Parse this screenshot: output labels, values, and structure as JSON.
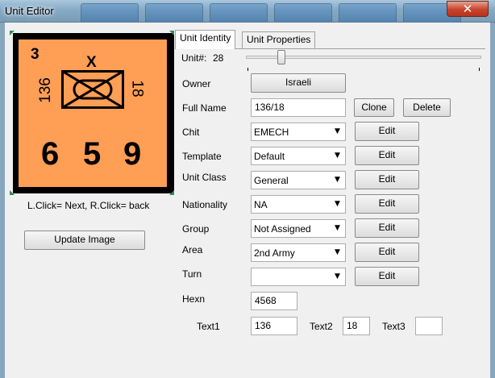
{
  "window": {
    "title": "Unit Editor",
    "close_glyph": "✕"
  },
  "counter": {
    "strength": "3",
    "size": "X",
    "left_label": "136",
    "right_label": "18",
    "stats": [
      "6",
      "5",
      "9"
    ],
    "bg_color": "#ff9e55",
    "corner_color": "#2f8a5a"
  },
  "hint": "L.Click= Next, R.Click= back",
  "update_image_label": "Update Image",
  "tabs": [
    "Unit Identity",
    "Unit Properties"
  ],
  "unit_number": {
    "label": "Unit#:",
    "value": "28"
  },
  "fields": {
    "owner": {
      "label": "Owner",
      "button": "Israeli"
    },
    "full_name": {
      "label": "Full Name",
      "value": "136/18",
      "clone": "Clone",
      "delete": "Delete"
    },
    "chit": {
      "label": "Chit",
      "value": "EMECH",
      "edit": "Edit"
    },
    "template": {
      "label": "Template",
      "value": "Default",
      "edit": "Edit"
    },
    "unit_class": {
      "label": "Unit Class",
      "value": "General",
      "edit": "Edit"
    },
    "nationality": {
      "label": "Nationality",
      "value": "NA",
      "edit": "Edit"
    },
    "group": {
      "label": "Group",
      "value": "Not Assigned",
      "edit": "Edit"
    },
    "area": {
      "label": "Area",
      "value": "2nd Army",
      "edit": "Edit"
    },
    "turn": {
      "label": "Turn",
      "value": "",
      "edit": "Edit"
    },
    "hexn": {
      "label": "Hexn",
      "value": "4568"
    },
    "text1": {
      "label": "Text1",
      "value": "136"
    },
    "text2": {
      "label": "Text2",
      "value": "18"
    },
    "text3": {
      "label": "Text3",
      "value": ""
    }
  },
  "icons": {
    "dropdown": "chevron-down-icon",
    "close": "close-icon",
    "unit_symbol": "mech-infantry-symbol-icon"
  }
}
